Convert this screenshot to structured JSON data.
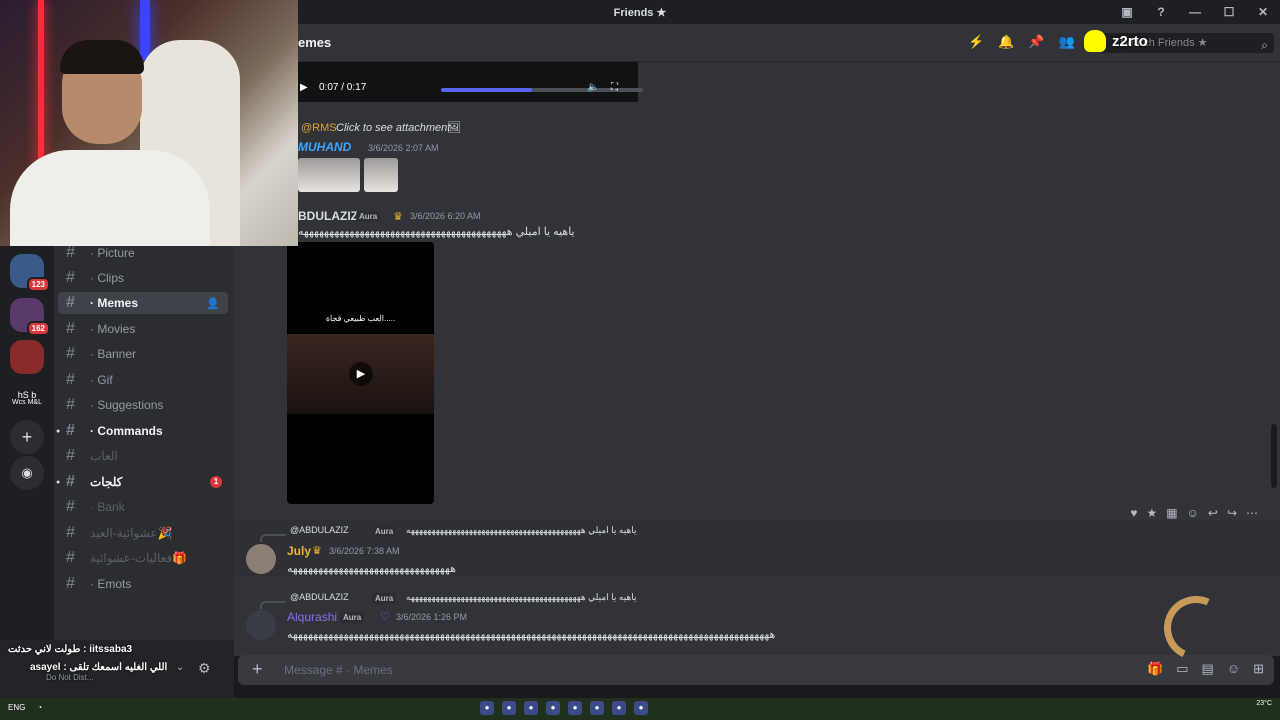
{
  "titlebar": {
    "title": "Friends ★"
  },
  "header": {
    "channel_name": "emes",
    "search_placeholder": "Search Friends ★",
    "overlay_handle": "z2rto"
  },
  "video_player": {
    "time": "0:07 / 0:17",
    "progress": 0.45
  },
  "messages": {
    "attachment_mention": "@RMS",
    "attachment_text": "Click to see attachment",
    "muhand": {
      "author": "MUHAND",
      "time": "3/6/2026 2:07 AM"
    },
    "abdulaziz": {
      "author": "BDULAZIZ",
      "tag": "Aura",
      "time": "3/6/2026 6:20 AM",
      "text": "ياهيه يا اميلي هههههههههههههههههههههههههههههههههههههههههه"
    },
    "video_caption": "العب طبيعي قجاة.....",
    "july": {
      "reply_author": "@ABDULAZIZ",
      "reply_tag": "Aura",
      "reply_text": "ياهيه يا اميلي ههههههههههههههههههههههههههههههههههههههههههه",
      "author": "July",
      "time": "3/6/2026 7:38 AM",
      "text": "ههههههههههههههههههههههههههههههههه"
    },
    "alqurashi": {
      "reply_author": "@ABDULAZIZ",
      "reply_tag": "Aura",
      "reply_text": "ياهيه يا اميلي ههههههههههههههههههههههههههههههههههههههههههه",
      "author": "Alqurashi",
      "tag": "Aura",
      "time": "3/6/2026 1:26 PM",
      "text": "هههههههههههههههههههههههههههههههههههههههههههههههههههههههههههههههههههههههههههههههههههههههههههههههه"
    }
  },
  "composer": {
    "placeholder": "Message # · Memes"
  },
  "servers": [
    {
      "label": "",
      "badge": "123"
    },
    {
      "label": "",
      "badge": "162"
    },
    {
      "label": "",
      "badge": ""
    },
    {
      "label": "hS   b",
      "badge": ""
    },
    {
      "label": "Wcs M&L",
      "badge": ""
    }
  ],
  "channels": [
    {
      "label": "· Picture",
      "style": "normal"
    },
    {
      "label": "· Clips",
      "style": "normal"
    },
    {
      "label": "· Memes",
      "style": "active"
    },
    {
      "label": "· Movies",
      "style": "normal"
    },
    {
      "label": "· Banner",
      "style": "normal"
    },
    {
      "label": "· Gif",
      "style": "normal"
    },
    {
      "label": "· Suggestions",
      "style": "normal"
    },
    {
      "label": "· Commands",
      "style": "bold"
    },
    {
      "label": "العاب",
      "style": "muted"
    },
    {
      "label": "كلجات",
      "style": "bold",
      "badge": "1"
    },
    {
      "label": "· Bank",
      "style": "muted"
    },
    {
      "label": "عشوائية-العيد🎉",
      "style": "muted"
    },
    {
      "label": "فعاليات-عشوائية🎁",
      "style": "muted"
    },
    {
      "label": "· Emots",
      "style": "normal"
    }
  ],
  "overlay": {
    "line1": "طولت لاني حدثت : iitssaba3",
    "line2": "asayel : اللي الغليه اسمعك تلقى",
    "status": "Do Not Dist..."
  },
  "taskbar": {
    "lang": "ENG",
    "clock": "23°C"
  },
  "colors": {
    "accent": "#5865f2",
    "muhand": "#3ea6ff",
    "july": "#f0b232",
    "alqurashi": "#8e6cf0",
    "mention": "#e0a030"
  }
}
